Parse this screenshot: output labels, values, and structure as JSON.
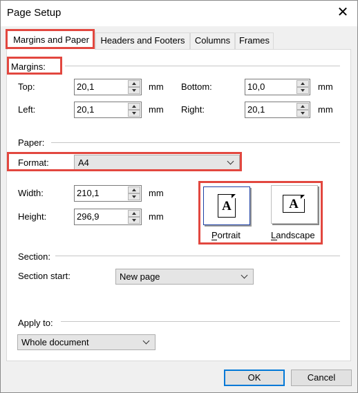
{
  "window": {
    "title": "Page Setup",
    "close_glyph": "✕"
  },
  "tabs": [
    {
      "label": "Margins and Paper",
      "active": true
    },
    {
      "label": "Headers and Footers",
      "active": false
    },
    {
      "label": "Columns",
      "active": false
    },
    {
      "label": "Frames",
      "active": false
    }
  ],
  "margins": {
    "header": "Margins:",
    "top": {
      "label": "Top:",
      "value": "20,1",
      "unit": "mm"
    },
    "bottom": {
      "label": "Bottom:",
      "value": "10,0",
      "unit": "mm"
    },
    "left": {
      "label": "Left:",
      "value": "20,1",
      "unit": "mm"
    },
    "right": {
      "label": "Right:",
      "value": "20,1",
      "unit": "mm"
    }
  },
  "paper": {
    "header": "Paper:",
    "format_label": "Format:",
    "format_value": "A4",
    "width": {
      "label": "Width:",
      "value": "210,1",
      "unit": "mm"
    },
    "height": {
      "label": "Height:",
      "value": "296,9",
      "unit": "mm"
    },
    "orientation": {
      "portrait_label": "Portrait",
      "landscape_label": "Landscape",
      "selected": "portrait",
      "glyph_letter": "A"
    }
  },
  "section": {
    "header": "Section:",
    "start_label": "Section start:",
    "start_value": "New page"
  },
  "apply": {
    "header": "Apply to:",
    "value": "Whole document"
  },
  "buttons": {
    "ok": "OK",
    "cancel": "Cancel"
  },
  "colors": {
    "highlight": "#e2473f",
    "focus": "#0078d7"
  }
}
